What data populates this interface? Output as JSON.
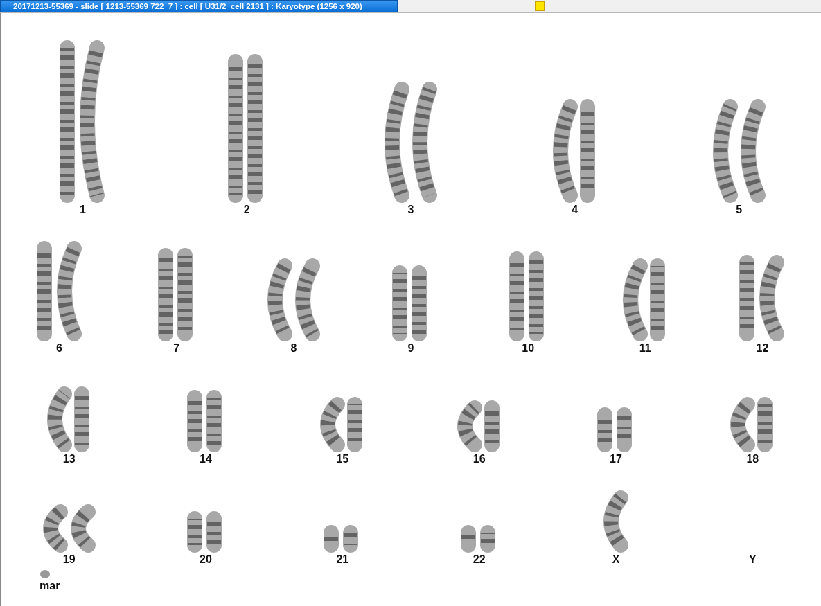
{
  "window": {
    "title": "20171213-55369 - slide [ 1213-55369 722_7 ] : cell [ U31/2_cell 2131 ] : Karyotype  (1256 x 920)"
  },
  "karyotype": {
    "rows": [
      [
        {
          "label": "1",
          "chromosomes": [
            {
              "kind": "straight"
            },
            {
              "kind": "bent"
            }
          ]
        },
        {
          "label": "2",
          "chromosomes": [
            {
              "kind": "straight"
            },
            {
              "kind": "straight"
            }
          ]
        },
        {
          "label": "3",
          "chromosomes": [
            {
              "kind": "bent"
            },
            {
              "kind": "bent"
            }
          ]
        },
        {
          "label": "4",
          "chromosomes": [
            {
              "kind": "bent"
            },
            {
              "kind": "straight"
            }
          ]
        },
        {
          "label": "5",
          "chromosomes": [
            {
              "kind": "bent"
            },
            {
              "kind": "bent"
            }
          ]
        }
      ],
      [
        {
          "label": "6",
          "chromosomes": [
            {
              "kind": "straight"
            },
            {
              "kind": "bent"
            }
          ]
        },
        {
          "label": "7",
          "chromosomes": [
            {
              "kind": "straight"
            },
            {
              "kind": "straight"
            }
          ]
        },
        {
          "label": "8",
          "chromosomes": [
            {
              "kind": "bent"
            },
            {
              "kind": "bent"
            }
          ]
        },
        {
          "label": "9",
          "chromosomes": [
            {
              "kind": "straight"
            },
            {
              "kind": "straight"
            }
          ]
        },
        {
          "label": "10",
          "chromosomes": [
            {
              "kind": "straight"
            },
            {
              "kind": "straight"
            }
          ]
        },
        {
          "label": "11",
          "chromosomes": [
            {
              "kind": "bent"
            },
            {
              "kind": "straight"
            }
          ]
        },
        {
          "label": "12",
          "chromosomes": [
            {
              "kind": "straight"
            },
            {
              "kind": "bent"
            }
          ]
        }
      ],
      [
        {
          "label": "13",
          "chromosomes": [
            {
              "kind": "bent"
            },
            {
              "kind": "straight"
            }
          ]
        },
        {
          "label": "14",
          "chromosomes": [
            {
              "kind": "straight"
            },
            {
              "kind": "straight"
            }
          ]
        },
        {
          "label": "15",
          "chromosomes": [
            {
              "kind": "bent"
            },
            {
              "kind": "straight"
            }
          ]
        },
        {
          "label": "16",
          "chromosomes": [
            {
              "kind": "bent"
            },
            {
              "kind": "straight"
            }
          ]
        },
        {
          "label": "17",
          "chromosomes": [
            {
              "kind": "straight"
            },
            {
              "kind": "straight"
            }
          ]
        },
        {
          "label": "18",
          "chromosomes": [
            {
              "kind": "bent"
            },
            {
              "kind": "straight"
            }
          ]
        }
      ],
      [
        {
          "label": "19",
          "chromosomes": [
            {
              "kind": "bent"
            },
            {
              "kind": "bent"
            }
          ]
        },
        {
          "label": "20",
          "chromosomes": [
            {
              "kind": "straight"
            },
            {
              "kind": "straight"
            }
          ]
        },
        {
          "label": "21",
          "chromosomes": [
            {
              "kind": "straight"
            },
            {
              "kind": "straight"
            }
          ]
        },
        {
          "label": "22",
          "chromosomes": [
            {
              "kind": "straight"
            },
            {
              "kind": "straight"
            }
          ]
        },
        {
          "label": "X",
          "chromosomes": [
            {
              "kind": "bent"
            }
          ]
        },
        {
          "label": "Y"
        }
      ]
    ],
    "marker": {
      "label": "mar",
      "chromosomes": [
        {
          "kind": "fragment"
        }
      ]
    }
  }
}
